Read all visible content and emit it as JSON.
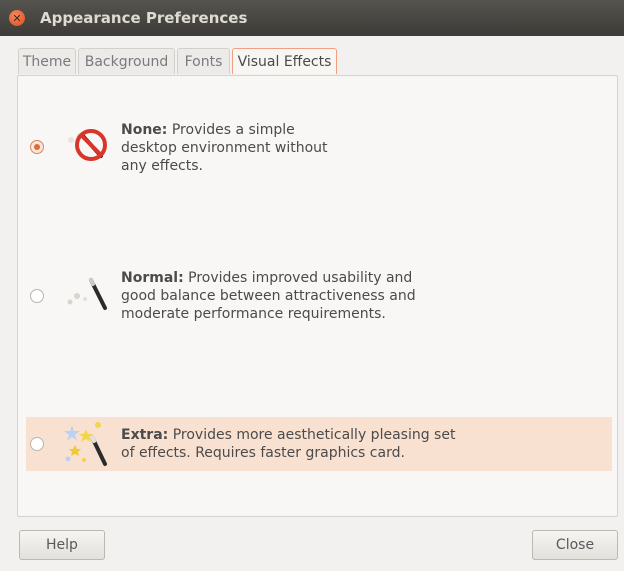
{
  "window": {
    "title": "Appearance Preferences"
  },
  "tabs": [
    {
      "label": "Theme"
    },
    {
      "label": "Background"
    },
    {
      "label": "Fonts"
    },
    {
      "label": "Visual Effects",
      "active": true
    }
  ],
  "options": [
    {
      "title": "None:",
      "description": "Provides a simple",
      "line2": "desktop environment without",
      "line3": "any effects.",
      "selected": true,
      "icon": "no-effects-icon"
    },
    {
      "title": "Normal:",
      "description": "Provides improved usability and",
      "line2": "good balance between attractiveness and",
      "line3": "moderate performance requirements.",
      "selected": false,
      "icon": "magic-wand-icon"
    },
    {
      "title": "Extra:",
      "description": "Provides more aesthetically pleasing set",
      "line2": "of effects. Requires faster graphics card.",
      "selected": false,
      "icon": "sparkle-wand-icon"
    }
  ],
  "buttons": {
    "help": "Help",
    "close": "Close"
  },
  "colors": {
    "accent": "#e06a3a",
    "highlight": "#f9e1d1",
    "titlebar": "#3c3b37"
  }
}
